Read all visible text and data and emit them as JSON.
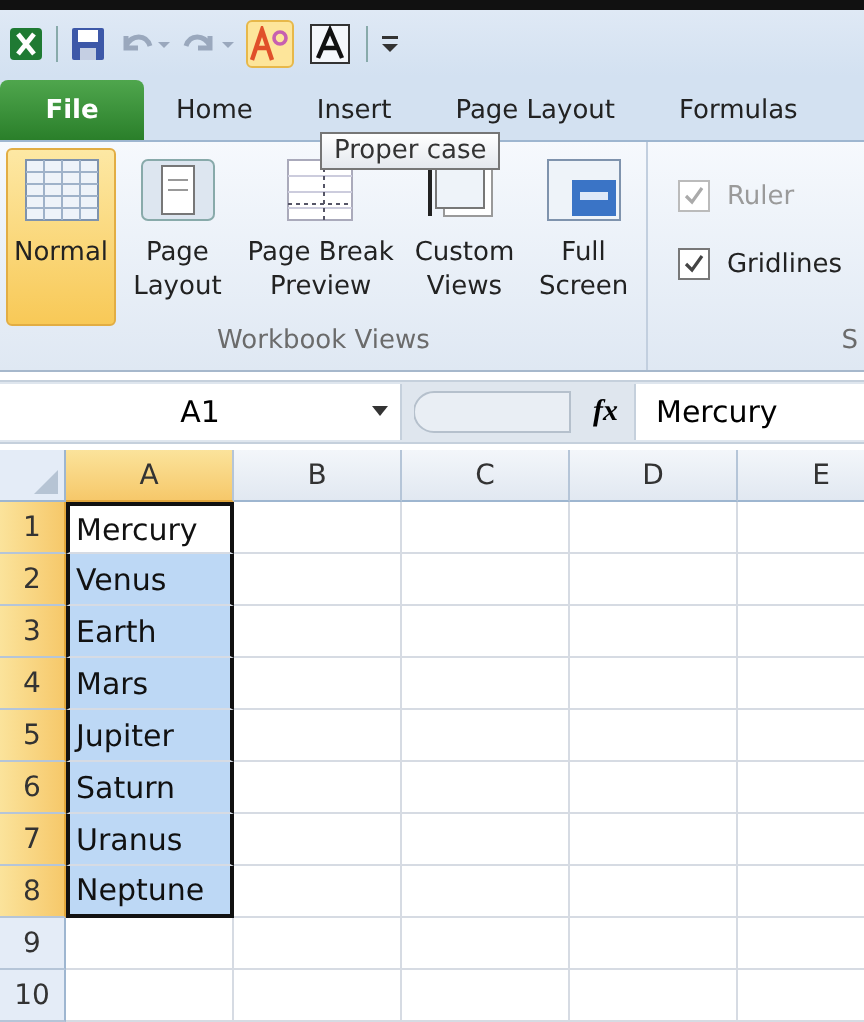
{
  "quick_access": {
    "tooltip": "Proper case"
  },
  "tabs": [
    {
      "label": "File",
      "kind": "file"
    },
    {
      "label": "Home",
      "kind": "tab"
    },
    {
      "label": "Insert",
      "kind": "tab"
    },
    {
      "label": "Page Layout",
      "kind": "tab"
    },
    {
      "label": "Formulas",
      "kind": "tab"
    }
  ],
  "ribbon": {
    "views": [
      {
        "label": "Normal",
        "selected": true
      },
      {
        "label": "Page Layout",
        "selected": false
      },
      {
        "label": "Page Break Preview",
        "selected": false
      },
      {
        "label": "Custom Views",
        "selected": false
      },
      {
        "label": "Full Screen",
        "selected": false
      }
    ],
    "group_label": "Workbook Views",
    "options": [
      {
        "label": "Ruler",
        "checked": true,
        "disabled": true
      },
      {
        "label": "Gridlines",
        "checked": true,
        "disabled": false
      }
    ],
    "next_group_label": "S"
  },
  "formula_bar": {
    "name_box": "A1",
    "function_label": "fx",
    "value": "Mercury"
  },
  "sheet": {
    "columns": [
      {
        "label": "A",
        "selected": true
      },
      {
        "label": "B",
        "selected": false
      },
      {
        "label": "C",
        "selected": false
      },
      {
        "label": "D",
        "selected": false
      },
      {
        "label": "E",
        "selected": false
      }
    ],
    "rows": [
      {
        "number": "1",
        "selected": true,
        "cell": "Mercury",
        "active": true
      },
      {
        "number": "2",
        "selected": true,
        "cell": "Venus",
        "active": false
      },
      {
        "number": "3",
        "selected": true,
        "cell": "Earth",
        "active": false
      },
      {
        "number": "4",
        "selected": true,
        "cell": "Mars",
        "active": false
      },
      {
        "number": "5",
        "selected": true,
        "cell": "Jupiter",
        "active": false
      },
      {
        "number": "6",
        "selected": true,
        "cell": "Saturn",
        "active": false
      },
      {
        "number": "7",
        "selected": true,
        "cell": "Uranus",
        "active": false
      },
      {
        "number": "8",
        "selected": true,
        "cell": "Neptune",
        "active": false
      },
      {
        "number": "9",
        "selected": false,
        "cell": "",
        "active": false
      },
      {
        "number": "10",
        "selected": false,
        "cell": "",
        "active": false
      }
    ]
  }
}
